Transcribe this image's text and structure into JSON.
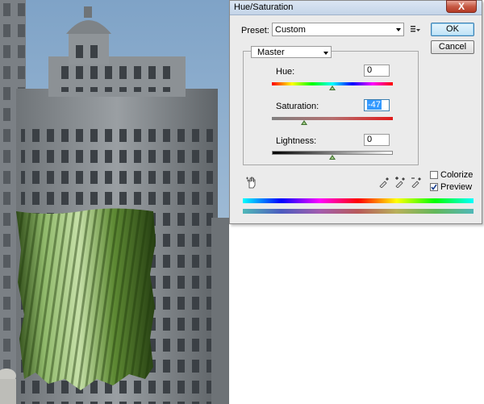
{
  "dialog": {
    "title": "Hue/Saturation",
    "close_label": "X",
    "preset": {
      "label": "Preset:",
      "value": "Custom"
    },
    "buttons": {
      "ok": "OK",
      "cancel": "Cancel"
    },
    "channel": {
      "value": "Master"
    },
    "sliders": {
      "hue": {
        "label": "Hue:",
        "value": "0"
      },
      "saturation": {
        "label": "Saturation:",
        "value": "-47"
      },
      "lightness": {
        "label": "Lightness:",
        "value": "0"
      }
    },
    "options": {
      "colorize": {
        "label": "Colorize",
        "checked": false
      },
      "preview": {
        "label": "Preview",
        "checked": true
      }
    }
  },
  "icons": [
    "preset-options-icon",
    "hand-adjust-icon",
    "eyedropper-icon",
    "eyedropper-plus-icon",
    "eyedropper-minus-icon",
    "chevron-down-icon",
    "slider-thumb-icon"
  ]
}
